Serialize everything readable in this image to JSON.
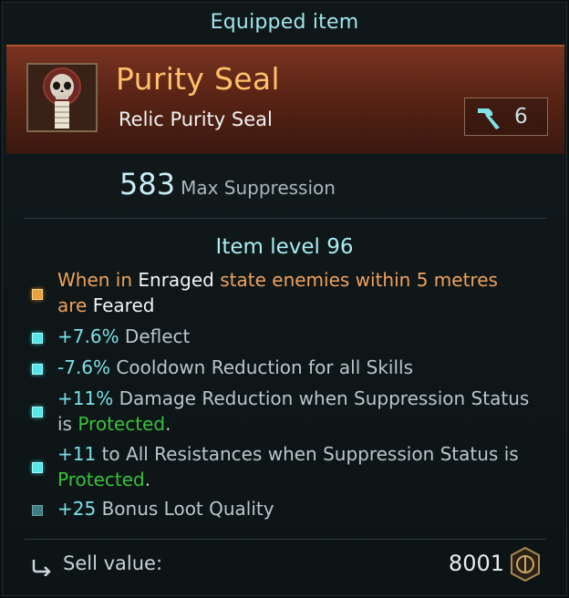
{
  "header": {
    "title": "Equipped item"
  },
  "item": {
    "name": "Purity Seal",
    "subtitle": "Relic Purity Seal",
    "icon": "skull-seal-icon",
    "upgrade_level": "6",
    "upgrade_icon": "hammer-icon"
  },
  "main_stat": {
    "value": "583",
    "label": "Max Suppression"
  },
  "item_level": "Item level 96",
  "properties": [
    {
      "bullet": "gold",
      "parts": [
        "When in ",
        "Enraged",
        " state enemies within 5 metres",
        "are ",
        "Feared"
      ]
    },
    {
      "bullet": "cyan",
      "value": "+7.6%",
      "label": " Deflect"
    },
    {
      "bullet": "cyan",
      "value": "-7.6%",
      "label": " Cooldown Reduction for all Skills"
    },
    {
      "bullet": "cyan",
      "value": "+11%",
      "label": " Damage Reduction when Suppression Status",
      "label2": "is ",
      "status": "Protected",
      "end": "."
    },
    {
      "bullet": "cyan",
      "value": "+11",
      "label": " to All Resistances when Suppression Status is",
      "status": "Protected",
      "end": "."
    },
    {
      "bullet": "teal",
      "value": "+25",
      "label": " Bonus Loot Quality"
    }
  ],
  "sell": {
    "label": "Sell value:",
    "value": "8001",
    "icon": "coin-icon",
    "return_icon": "return-arrow-icon"
  },
  "colors": {
    "name": "#ffbf6b",
    "accent_cyan": "#78e1e6",
    "status_green": "#38c13a",
    "hero_bg": "#7a3320"
  }
}
